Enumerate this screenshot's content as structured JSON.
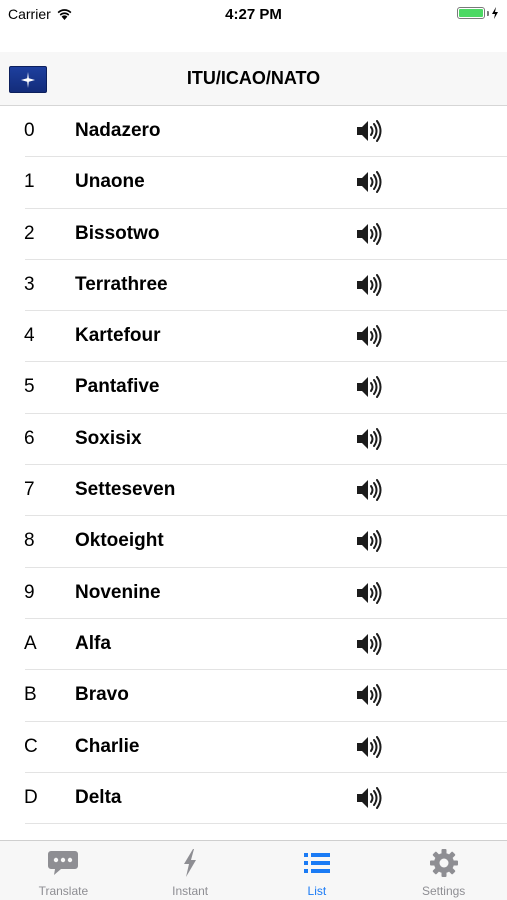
{
  "status_bar": {
    "carrier": "Carrier",
    "time": "4:27 PM"
  },
  "nav": {
    "title": "ITU/ICAO/NATO"
  },
  "items": [
    {
      "char": "0",
      "word": "Nadazero"
    },
    {
      "char": "1",
      "word": "Unaone"
    },
    {
      "char": "2",
      "word": "Bissotwo"
    },
    {
      "char": "3",
      "word": "Terrathree"
    },
    {
      "char": "4",
      "word": "Kartefour"
    },
    {
      "char": "5",
      "word": "Pantafive"
    },
    {
      "char": "6",
      "word": "Soxisix"
    },
    {
      "char": "7",
      "word": "Setteseven"
    },
    {
      "char": "8",
      "word": "Oktoeight"
    },
    {
      "char": "9",
      "word": "Novenine"
    },
    {
      "char": "A",
      "word": "Alfa"
    },
    {
      "char": "B",
      "word": "Bravo"
    },
    {
      "char": "C",
      "word": "Charlie"
    },
    {
      "char": "D",
      "word": "Delta"
    }
  ],
  "tabs": [
    {
      "label": "Translate",
      "icon": "speech-bubble-icon"
    },
    {
      "label": "Instant",
      "icon": "lightning-icon"
    },
    {
      "label": "List",
      "icon": "list-icon",
      "active": true
    },
    {
      "label": "Settings",
      "icon": "gear-icon"
    }
  ],
  "colors": {
    "accent": "#1a7bf5",
    "inactive": "#8e8e93",
    "battery": "#4cd964",
    "flag": "#1d3f9e"
  }
}
